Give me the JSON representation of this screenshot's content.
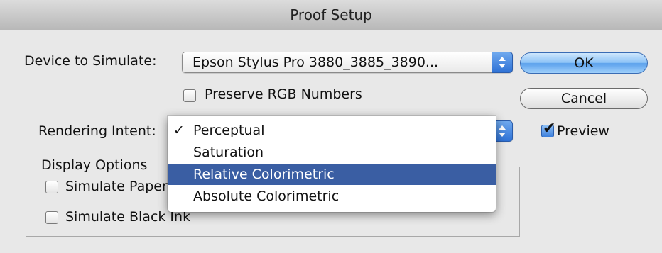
{
  "window": {
    "title": "Proof Setup"
  },
  "device": {
    "label": "Device to Simulate:",
    "selected": "Epson Stylus Pro 3880_3885_3890..."
  },
  "preserve_rgb": {
    "label": "Preserve RGB Numbers",
    "checked": false
  },
  "rendering_intent": {
    "label": "Rendering Intent:",
    "options": [
      {
        "label": "Perceptual",
        "selected": true,
        "highlighted": false
      },
      {
        "label": "Saturation",
        "selected": false,
        "highlighted": false
      },
      {
        "label": "Relative Colorimetric",
        "selected": false,
        "highlighted": true
      },
      {
        "label": "Absolute Colorimetric",
        "selected": false,
        "highlighted": false
      }
    ]
  },
  "buttons": {
    "ok": "OK",
    "cancel": "Cancel"
  },
  "preview": {
    "label": "Preview",
    "checked": true
  },
  "display_options": {
    "title": "Display Options",
    "simulate_paper": {
      "label": "Simulate Paper",
      "checked": false
    },
    "simulate_ink": {
      "label": "Simulate Black Ink",
      "checked": false
    }
  },
  "glyphs": {
    "check": "✓",
    "checkbox_tick": "✔"
  },
  "colors": {
    "highlight": "#3a5ea3",
    "default_button": "#8cc2f6",
    "stepper": "#2f72d6"
  }
}
